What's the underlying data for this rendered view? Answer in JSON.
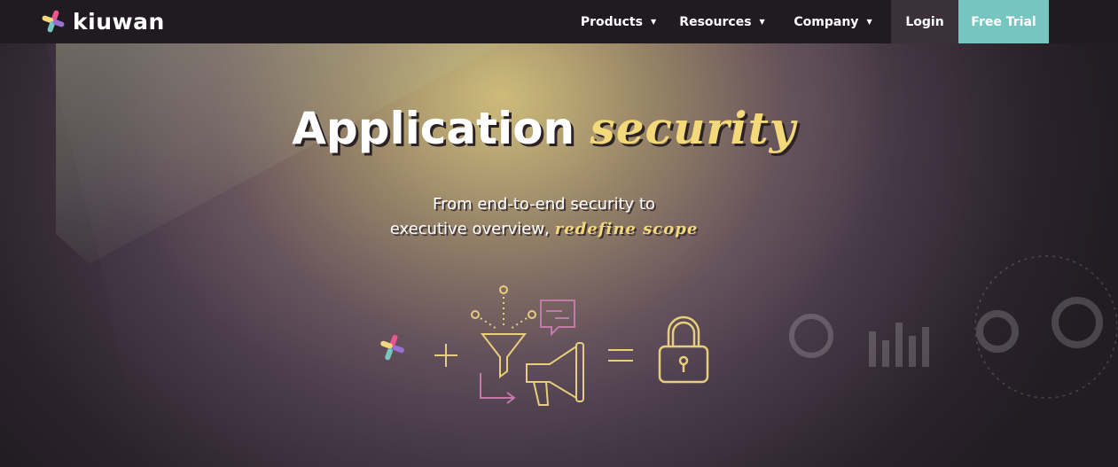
{
  "brand": {
    "name": "kiuwan",
    "logo_colors": [
      "#e8558f",
      "#f3d97a",
      "#77c5c0",
      "#9a6fd0"
    ]
  },
  "nav": {
    "items": [
      {
        "label": "Products",
        "has_dropdown": true
      },
      {
        "label": "Resources",
        "has_dropdown": true
      },
      {
        "label": "Company",
        "has_dropdown": true
      }
    ],
    "login_label": "Login",
    "trial_label": "Free Trial",
    "trial_color": "#77c5c0"
  },
  "hero": {
    "title_main": "Application",
    "title_accent": "security",
    "subtitle_line1": "From end-to-end security to",
    "subtitle_line2": "executive overview,",
    "subtitle_accent": "redefine scope",
    "accent_color": "#f3d97a",
    "illustration": {
      "items": [
        "kiuwan-logo",
        "plus",
        "funnel",
        "megaphone",
        "equals",
        "padlock"
      ]
    }
  }
}
